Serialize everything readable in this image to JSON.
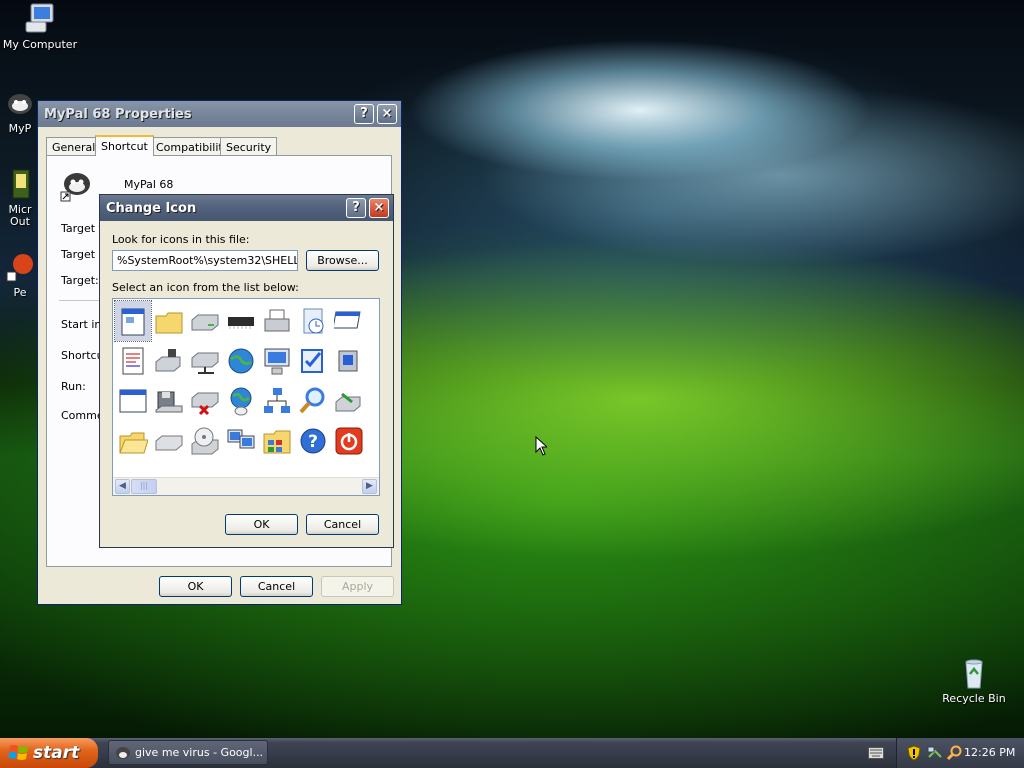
{
  "desktop": {
    "icons": {
      "my_computer": "My Computer",
      "mypal": "MyP",
      "outlook_1": "Micr",
      "outlook_2": "Out",
      "pe": "Pe",
      "recycle_bin": "Recycle Bin"
    }
  },
  "properties_dialog": {
    "title": "MyPal 68 Properties",
    "help_btn": "?",
    "close_btn": "×",
    "tabs": [
      "General",
      "Shortcut",
      "Compatibility",
      "Security"
    ],
    "selected_tab": "Shortcut",
    "app_name": "MyPal 68",
    "labels": {
      "target_type": "Target ty",
      "target_location": "Target lo",
      "target": "Target:",
      "start_in": "Start in:",
      "shortcut_key": "Shortcu",
      "run": "Run:",
      "comment": "Commen"
    },
    "buttons": {
      "ok": "OK",
      "cancel": "Cancel",
      "apply": "Apply"
    }
  },
  "change_icon_dialog": {
    "title": "Change Icon",
    "help_btn": "?",
    "close_btn": "×",
    "file_label": "Look for icons in this file:",
    "file_value": "%SystemRoot%\\system32\\SHELL32",
    "browse": "Browse...",
    "list_label": "Select an icon from the list below:",
    "icons": [
      [
        "document-window-icon",
        "folder-icon",
        "hard-drive-icon",
        "memory-chip-icon",
        "printer-icon",
        "clock-document-icon",
        "window-app-icon"
      ],
      [
        "text-document-icon",
        "network-drive-icon",
        "network-drive-2-icon",
        "globe-icon",
        "network-computer-icon",
        "checklist-icon",
        "removable-drive-icon"
      ],
      [
        "blank-window-icon",
        "floppy-drive-icon",
        "disconnected-drive-icon",
        "world-mouse-icon",
        "network-map-icon",
        "search-magnifier-icon",
        "drive-arrow-icon"
      ],
      [
        "open-folder-icon",
        "cd-drive-icon",
        "cd-disc-icon",
        "network-computers-icon",
        "control-panel-folder-icon",
        "help-icon",
        "shutdown-icon"
      ]
    ],
    "buttons": {
      "ok": "OK",
      "cancel": "Cancel"
    }
  },
  "taskbar": {
    "start": "start",
    "task_item": "give me virus - Googl...",
    "clock": "12:26 PM"
  }
}
